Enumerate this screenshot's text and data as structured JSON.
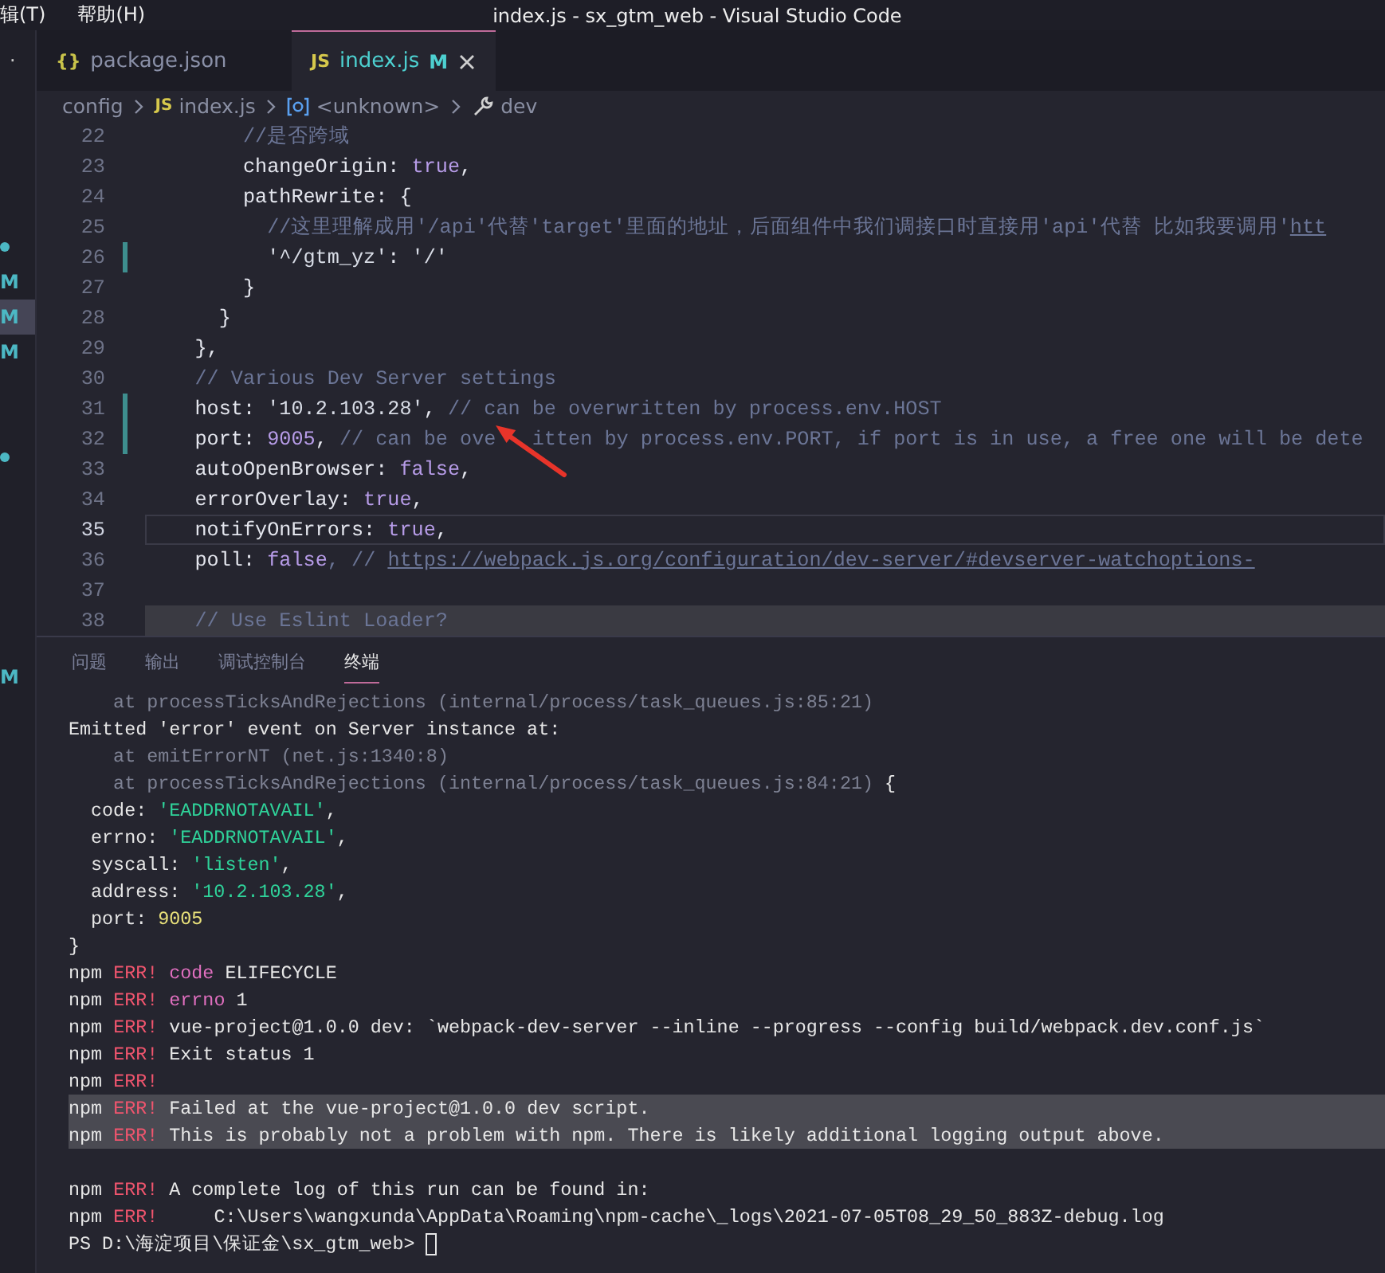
{
  "menu": [
    "辑(T)",
    "帮助(H)"
  ],
  "window": {
    "title": "index.js - sx_gtm_web - Visual Studio Code"
  },
  "explorer_edge": {
    "overflow": "·",
    "items": [
      {
        "kind": "dot",
        "selected": false
      },
      {
        "kind": "letter",
        "text": "M",
        "selected": false
      },
      {
        "kind": "letter",
        "text": "M",
        "selected": true
      },
      {
        "kind": "letter",
        "text": "M",
        "selected": false
      },
      {
        "kind": "blank",
        "selected": false
      },
      {
        "kind": "blank",
        "selected": false
      },
      {
        "kind": "dot",
        "selected": false
      }
    ],
    "panel_mark": "M"
  },
  "tabs": [
    {
      "kind": "json",
      "icon": "{}",
      "label": "package.json",
      "selected": false
    },
    {
      "kind": "js",
      "icon": "JS",
      "label": "index.js",
      "badge": "M",
      "selected": true
    }
  ],
  "breadcrumb": [
    {
      "kind": "folder",
      "label": "config"
    },
    {
      "kind": "js",
      "icon": "JS",
      "label": "index.js"
    },
    {
      "kind": "symbol",
      "label": "<unknown>"
    },
    {
      "kind": "wrench",
      "label": "dev"
    }
  ],
  "editor": {
    "lines": [
      {
        "number": "22",
        "kind": "text",
        "modified": false,
        "current": false,
        "highlighted": false,
        "tokens": [
          {
            "t": "        //是否跨域",
            "kind": "comment"
          }
        ]
      },
      {
        "number": "23",
        "kind": "text",
        "modified": false,
        "current": false,
        "highlighted": false,
        "tokens": [
          {
            "t": "        changeOrigin",
            "kind": "key"
          },
          {
            "t": ": ",
            "kind": "punct"
          },
          {
            "t": "true",
            "kind": "bool"
          },
          {
            "t": ",",
            "kind": "punct"
          }
        ]
      },
      {
        "number": "24",
        "kind": "text",
        "modified": false,
        "current": false,
        "highlighted": false,
        "tokens": [
          {
            "t": "        pathRewrite",
            "kind": "key"
          },
          {
            "t": ": {",
            "kind": "punct"
          }
        ]
      },
      {
        "number": "25",
        "kind": "text",
        "modified": false,
        "current": false,
        "highlighted": false,
        "tokens": [
          {
            "t": "          //这里理解成用'/api'代替'target'里面的地址，后面组件中我们调接口时直接用'api'代替 比如我要调用'",
            "kind": "comment"
          },
          {
            "t": "htt",
            "kind": "link"
          }
        ]
      },
      {
        "number": "26",
        "kind": "text",
        "modified": true,
        "current": false,
        "highlighted": false,
        "tokens": [
          {
            "t": "          '^/gtm_yz'",
            "kind": "string"
          },
          {
            "t": ": ",
            "kind": "punct"
          },
          {
            "t": "'/'",
            "kind": "string"
          }
        ]
      },
      {
        "number": "27",
        "kind": "text",
        "modified": false,
        "current": false,
        "highlighted": false,
        "tokens": [
          {
            "t": "        }",
            "kind": "punct"
          }
        ]
      },
      {
        "number": "28",
        "kind": "text",
        "modified": false,
        "current": false,
        "highlighted": false,
        "tokens": [
          {
            "t": "      }",
            "kind": "punct"
          }
        ]
      },
      {
        "number": "29",
        "kind": "text",
        "modified": false,
        "current": false,
        "highlighted": false,
        "tokens": [
          {
            "t": "    },",
            "kind": "punct"
          }
        ]
      },
      {
        "number": "30",
        "kind": "text",
        "modified": false,
        "current": false,
        "highlighted": false,
        "tokens": [
          {
            "t": "    // Various Dev Server settings",
            "kind": "comment"
          }
        ]
      },
      {
        "number": "31",
        "kind": "text",
        "modified": true,
        "current": false,
        "highlighted": false,
        "tokens": [
          {
            "t": "    host",
            "kind": "key"
          },
          {
            "t": ": ",
            "kind": "punct"
          },
          {
            "t": "'10.2.103.28'",
            "kind": "string"
          },
          {
            "t": ", ",
            "kind": "punct"
          },
          {
            "t": "// can be overwritten by process.env.HOST",
            "kind": "comment"
          }
        ]
      },
      {
        "number": "32",
        "kind": "text",
        "modified": true,
        "current": false,
        "highlighted": false,
        "tokens": [
          {
            "t": "    port",
            "kind": "key"
          },
          {
            "t": ": ",
            "kind": "punct"
          },
          {
            "t": "9005",
            "kind": "number"
          },
          {
            "t": ", ",
            "kind": "punct"
          },
          {
            "t": "// can be ove",
            "kind": "comment"
          },
          {
            "kind": "gap"
          },
          {
            "t": "itten by process.env.PORT, if port is in use, a free one will be dete",
            "kind": "comment"
          }
        ]
      },
      {
        "number": "33",
        "kind": "text",
        "modified": false,
        "current": false,
        "highlighted": false,
        "tokens": [
          {
            "t": "    autoOpenBrowser",
            "kind": "key"
          },
          {
            "t": ": ",
            "kind": "punct"
          },
          {
            "t": "false",
            "kind": "bool"
          },
          {
            "t": ",",
            "kind": "punct"
          }
        ]
      },
      {
        "number": "34",
        "kind": "text",
        "modified": false,
        "current": false,
        "highlighted": false,
        "tokens": [
          {
            "t": "    errorOverlay",
            "kind": "key"
          },
          {
            "t": ": ",
            "kind": "punct"
          },
          {
            "t": "true",
            "kind": "bool"
          },
          {
            "t": ",",
            "kind": "punct"
          }
        ]
      },
      {
        "number": "35",
        "kind": "text",
        "modified": false,
        "current": true,
        "highlighted": false,
        "tokens": [
          {
            "t": "    notifyOnErrors",
            "kind": "key"
          },
          {
            "t": ": ",
            "kind": "punct"
          },
          {
            "t": "true",
            "kind": "bool"
          },
          {
            "t": ",",
            "kind": "punct"
          }
        ]
      },
      {
        "number": "36",
        "kind": "text",
        "modified": false,
        "current": false,
        "highlighted": false,
        "tokens": [
          {
            "t": "    poll",
            "kind": "key"
          },
          {
            "t": ": ",
            "kind": "punct"
          },
          {
            "t": "false",
            "kind": "bool"
          },
          {
            "t": ", // ",
            "kind": "comment"
          },
          {
            "t": "https://webpack.js.org/configuration/dev-server/#devserver-watchoptions-",
            "kind": "link"
          }
        ]
      },
      {
        "number": "37",
        "kind": "blank",
        "modified": false,
        "current": false,
        "highlighted": false
      },
      {
        "number": "38",
        "kind": "text",
        "modified": false,
        "current": false,
        "highlighted": true,
        "tokens": [
          {
            "t": "    // Use Eslint Loader?",
            "kind": "comment"
          }
        ]
      }
    ]
  },
  "panel": {
    "tabs": [
      {
        "label": "问题",
        "selected": false
      },
      {
        "label": "输出",
        "selected": false
      },
      {
        "label": "调试控制台",
        "selected": false
      },
      {
        "label": "终端",
        "selected": true
      }
    ],
    "terminal": [
      {
        "kind": "text",
        "selected": false,
        "tokens": [
          {
            "t": "    at processTicksAndRejections (internal/process/task_queues.js:85:21)",
            "kind": "dim"
          }
        ]
      },
      {
        "kind": "text",
        "selected": false,
        "tokens": [
          {
            "t": "Emitted 'error' event on Server instance at:",
            "kind": "plain"
          }
        ]
      },
      {
        "kind": "text",
        "selected": false,
        "tokens": [
          {
            "t": "    at emitErrorNT (net.js:1340:8)",
            "kind": "dim"
          }
        ]
      },
      {
        "kind": "text",
        "selected": false,
        "tokens": [
          {
            "t": "    at processTicksAndRejections (internal/process/task_queues.js:84:21)",
            "kind": "dim"
          },
          {
            "t": " {",
            "kind": "plain"
          }
        ]
      },
      {
        "kind": "text",
        "selected": false,
        "tokens": [
          {
            "t": "  code: ",
            "kind": "plain"
          },
          {
            "t": "'EADDRNOTAVAIL'",
            "kind": "str"
          },
          {
            "t": ",",
            "kind": "plain"
          }
        ]
      },
      {
        "kind": "text",
        "selected": false,
        "tokens": [
          {
            "t": "  errno: ",
            "kind": "plain"
          },
          {
            "t": "'EADDRNOTAVAIL'",
            "kind": "str"
          },
          {
            "t": ",",
            "kind": "plain"
          }
        ]
      },
      {
        "kind": "text",
        "selected": false,
        "tokens": [
          {
            "t": "  syscall: ",
            "kind": "plain"
          },
          {
            "t": "'listen'",
            "kind": "str"
          },
          {
            "t": ",",
            "kind": "plain"
          }
        ]
      },
      {
        "kind": "text",
        "selected": false,
        "tokens": [
          {
            "t": "  address: ",
            "kind": "plain"
          },
          {
            "t": "'10.2.103.28'",
            "kind": "str"
          },
          {
            "t": ",",
            "kind": "plain"
          }
        ]
      },
      {
        "kind": "text",
        "selected": false,
        "tokens": [
          {
            "t": "  port: ",
            "kind": "plain"
          },
          {
            "t": "9005",
            "kind": "num"
          }
        ]
      },
      {
        "kind": "text",
        "selected": false,
        "tokens": [
          {
            "t": "}",
            "kind": "plain"
          }
        ]
      },
      {
        "kind": "text",
        "selected": false,
        "tokens": [
          {
            "t": "npm ",
            "kind": "plain"
          },
          {
            "t": "ERR!",
            "kind": "err"
          },
          {
            "t": " code",
            "kind": "kw"
          },
          {
            "t": " ELIFECYCLE",
            "kind": "plain"
          }
        ]
      },
      {
        "kind": "text",
        "selected": false,
        "tokens": [
          {
            "t": "npm ",
            "kind": "plain"
          },
          {
            "t": "ERR!",
            "kind": "err"
          },
          {
            "t": " errno",
            "kind": "kw"
          },
          {
            "t": " 1",
            "kind": "plain"
          }
        ]
      },
      {
        "kind": "text",
        "selected": false,
        "tokens": [
          {
            "t": "npm ",
            "kind": "plain"
          },
          {
            "t": "ERR!",
            "kind": "err"
          },
          {
            "t": " vue-project@1.0.0 dev: `webpack-dev-server --inline --progress --config build/webpack.dev.conf.js`",
            "kind": "plain"
          }
        ]
      },
      {
        "kind": "text",
        "selected": false,
        "tokens": [
          {
            "t": "npm ",
            "kind": "plain"
          },
          {
            "t": "ERR!",
            "kind": "err"
          },
          {
            "t": " Exit status 1",
            "kind": "plain"
          }
        ]
      },
      {
        "kind": "text",
        "selected": false,
        "tokens": [
          {
            "t": "npm ",
            "kind": "plain"
          },
          {
            "t": "ERR!",
            "kind": "err"
          }
        ]
      },
      {
        "kind": "text",
        "selected": true,
        "tokens": [
          {
            "t": "npm ",
            "kind": "plain"
          },
          {
            "t": "ERR!",
            "kind": "err"
          },
          {
            "t": " Failed at the vue-project@1.0.0 dev script.",
            "kind": "plain"
          }
        ]
      },
      {
        "kind": "text",
        "selected": true,
        "tokens": [
          {
            "t": "npm ",
            "kind": "plain"
          },
          {
            "t": "ERR!",
            "kind": "err"
          },
          {
            "t": " This is probably not a problem with npm. There is likely additional logging output above.",
            "kind": "plain"
          }
        ]
      },
      {
        "kind": "blank",
        "selected": false
      },
      {
        "kind": "text",
        "selected": false,
        "tokens": [
          {
            "t": "npm ",
            "kind": "plain"
          },
          {
            "t": "ERR!",
            "kind": "err"
          },
          {
            "t": " A complete log of this run can be found in:",
            "kind": "plain"
          }
        ]
      },
      {
        "kind": "text",
        "selected": false,
        "tokens": [
          {
            "t": "npm ",
            "kind": "plain"
          },
          {
            "t": "ERR!",
            "kind": "err"
          },
          {
            "t": "     C:\\Users\\wangxunda\\AppData\\Roaming\\npm-cache\\_logs\\2021-07-05T08_29_50_883Z-debug.log",
            "kind": "plain"
          }
        ]
      },
      {
        "kind": "prompt",
        "selected": false,
        "tokens": [
          {
            "t": "PS D:\\海淀项目\\保证金\\sx_gtm_web> ",
            "kind": "plain"
          }
        ]
      }
    ]
  }
}
